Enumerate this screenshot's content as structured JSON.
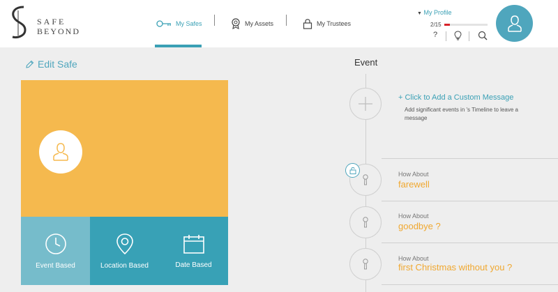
{
  "brand": {
    "line1": "SAFE",
    "line2": "BEYOND"
  },
  "nav": {
    "safes": "My Safes",
    "assets": "My Assets",
    "trustees": "My Trustees"
  },
  "profile": {
    "link": "My Profile",
    "progress_label": "2/15",
    "progress_fraction": 0.133,
    "help": "?"
  },
  "left": {
    "edit_label": "Edit Safe",
    "types": [
      {
        "label": "Event Based",
        "icon": "clock-icon"
      },
      {
        "label": "Location Based",
        "icon": "location-pin-icon"
      },
      {
        "label": "Date Based",
        "icon": "calendar-icon"
      }
    ]
  },
  "right": {
    "title": "Event",
    "add_message": "+ Click to Add a Custom Message",
    "add_description": "Add significant events in 's Timeline to leave a message",
    "events": [
      {
        "sub": "How About",
        "name": "farewell"
      },
      {
        "sub": "How About",
        "name": "goodbye ?"
      },
      {
        "sub": "How About",
        "name": "first Christmas without you ?"
      }
    ]
  },
  "colors": {
    "accent": "#3aa0b5",
    "card": "#f5b94e",
    "event_text": "#f0a830",
    "progress": "#d8232a"
  }
}
